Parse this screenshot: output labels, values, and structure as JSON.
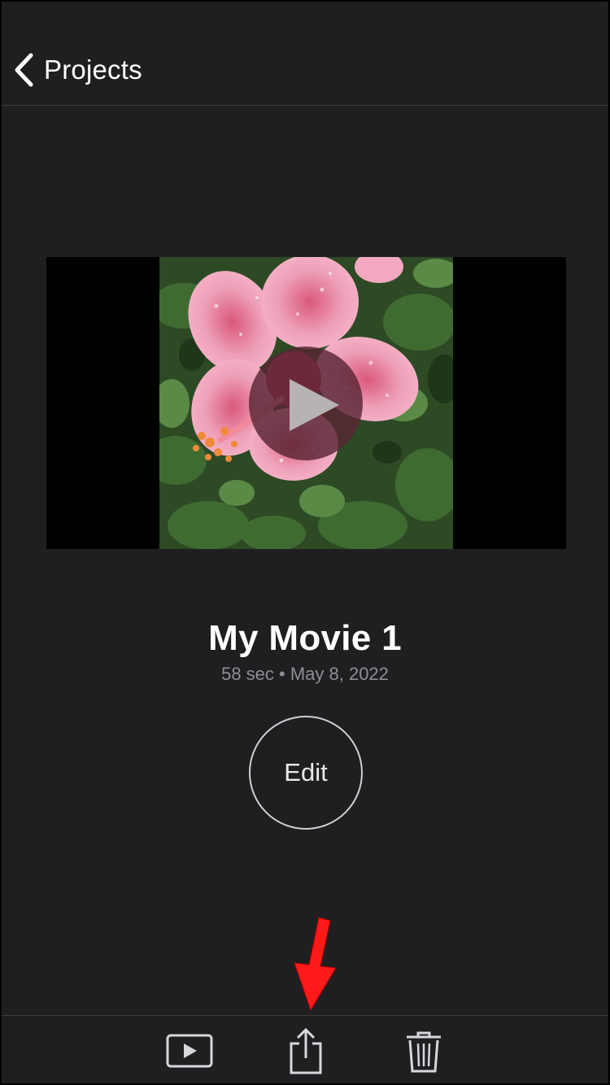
{
  "nav": {
    "back_label": "Projects"
  },
  "preview": {
    "thumbnail": "hibiscus-flower-photo",
    "play_icon": "play-icon"
  },
  "project": {
    "title": "My Movie 1",
    "meta": "58 sec • May 8, 2022"
  },
  "actions": {
    "edit_label": "Edit"
  },
  "toolbar": {
    "items": [
      {
        "icon": "play-video-icon"
      },
      {
        "icon": "share-icon"
      },
      {
        "icon": "trash-icon"
      }
    ]
  },
  "colors": {
    "background": "#1f1f21",
    "annotation_arrow": "#ff1a1a",
    "meta_text": "#8e8e93"
  }
}
